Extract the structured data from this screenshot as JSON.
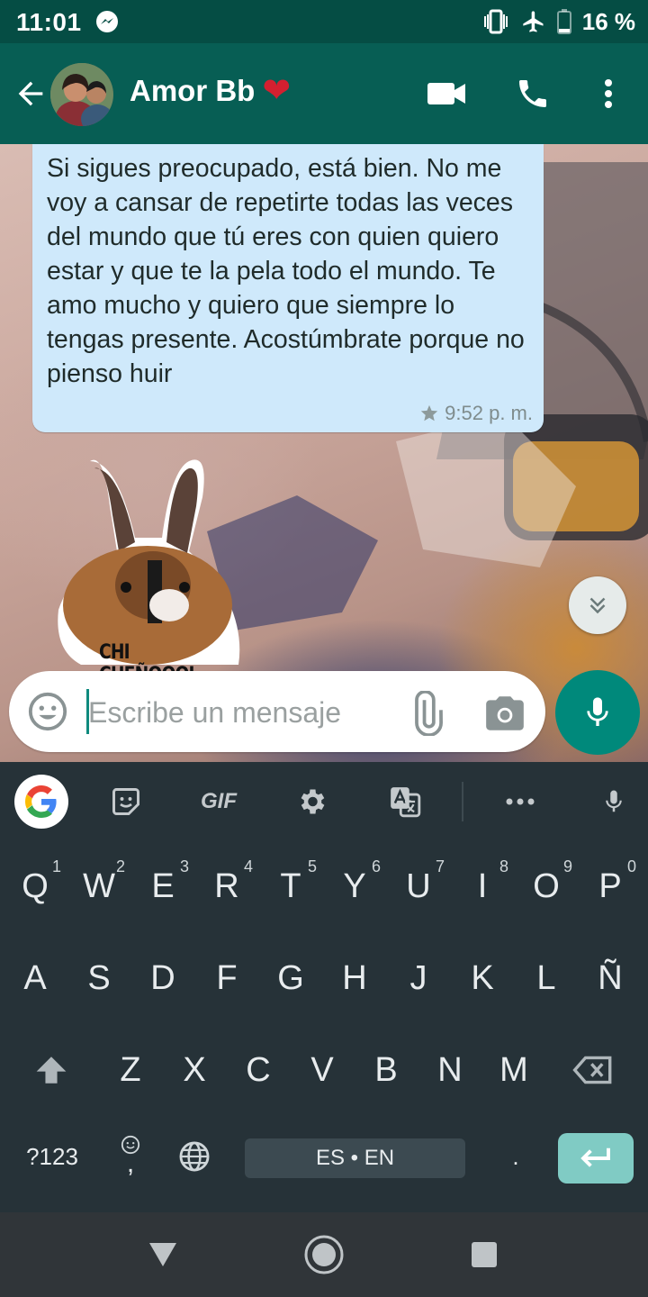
{
  "status_bar": {
    "time": "11:01",
    "battery_percent": "16 %",
    "icons": [
      "messenger-icon",
      "vibrate-icon",
      "airplane-mode-icon",
      "battery-icon"
    ]
  },
  "app_bar": {
    "contact_name": "Amor Bb",
    "heart": "❤",
    "icons": [
      "back-arrow-icon",
      "video-call-icon",
      "phone-call-icon",
      "more-vert-icon"
    ]
  },
  "chat": {
    "messages": [
      {
        "text": "Si sigues preocupado, está bien. No me voy a cansar de repetirte todas las veces del mundo que tú eres con quien quiero estar y que te la pela todo el mundo. Te amo mucho y quiero que siempre lo tengas presente. Acostúmbrate porque no pienso huir",
        "time": "9:52 p. m.",
        "starred": true
      }
    ],
    "sticker_caption": "CHI CHEÑOOOL"
  },
  "composer": {
    "placeholder": "Escribe un mensaje",
    "value": ""
  },
  "keyboard": {
    "toolbar_gif": "GIF",
    "row1": [
      {
        "key": "Q",
        "hint": "1"
      },
      {
        "key": "W",
        "hint": "2"
      },
      {
        "key": "E",
        "hint": "3"
      },
      {
        "key": "R",
        "hint": "4"
      },
      {
        "key": "T",
        "hint": "5"
      },
      {
        "key": "Y",
        "hint": "6"
      },
      {
        "key": "U",
        "hint": "7"
      },
      {
        "key": "I",
        "hint": "8"
      },
      {
        "key": "O",
        "hint": "9"
      },
      {
        "key": "P",
        "hint": "0"
      }
    ],
    "row2": [
      "A",
      "S",
      "D",
      "F",
      "G",
      "H",
      "J",
      "K",
      "L",
      "Ñ"
    ],
    "row3": [
      "Z",
      "X",
      "C",
      "V",
      "B",
      "N",
      "M"
    ],
    "symbols_key": "?123",
    "comma_key": ",",
    "space_label": "ES • EN",
    "period_key": "."
  },
  "colors": {
    "header": "#075e54",
    "status_bar": "#054d44",
    "accent": "#00897b",
    "bubble": "#cfe9fb",
    "keyboard_bg": "#263238"
  }
}
